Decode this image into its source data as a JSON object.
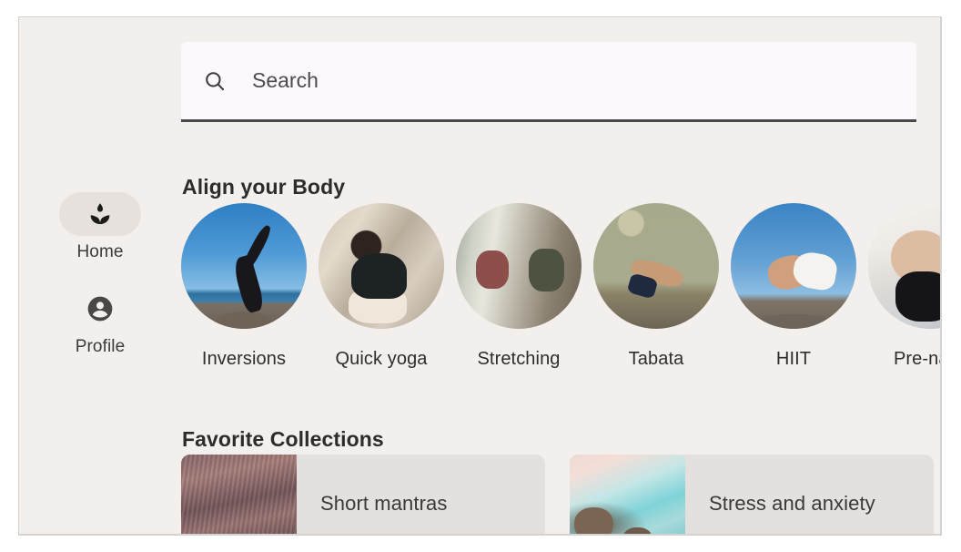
{
  "sidebar": {
    "items": [
      {
        "label": "Home",
        "icon": "lotus-icon",
        "active": true
      },
      {
        "label": "Profile",
        "icon": "account-circle-icon",
        "active": false
      }
    ]
  },
  "search": {
    "placeholder": "Search",
    "value": "",
    "icon": "search-icon"
  },
  "sections": {
    "body": {
      "title": "Align your Body",
      "categories": [
        {
          "label": "Inversions",
          "art": "sky-beach"
        },
        {
          "label": "Quick yoga",
          "art": "studio-roots"
        },
        {
          "label": "Stretching",
          "art": "window-studio"
        },
        {
          "label": "Tabata",
          "art": "olive-wall"
        },
        {
          "label": "HIIT",
          "art": "sky-rock"
        },
        {
          "label": "Pre-natal",
          "art": "prenatal"
        }
      ]
    },
    "favorites": {
      "title": "Favorite Collections",
      "cards": [
        {
          "label": "Short mantras",
          "art": "ocean-dusk"
        },
        {
          "label": "Stress and anxiety",
          "art": "turquoise-shore"
        }
      ]
    }
  },
  "colors": {
    "page_background": "#f2efec",
    "search_background": "#fbf9fc",
    "search_underline": "#4a484a",
    "active_pill": "#e7e1dd",
    "card_background": "#e4e0de",
    "text_primary": "#2d2c2d",
    "text_secondary": "#3b3b3b"
  }
}
